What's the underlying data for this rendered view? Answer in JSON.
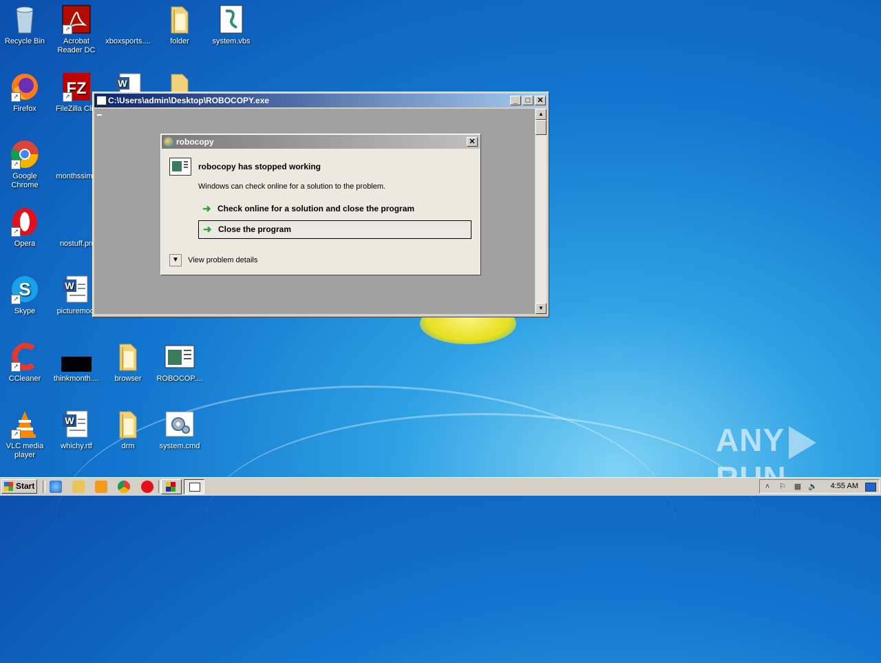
{
  "desktop": {
    "icons": [
      {
        "label": "Recycle Bin",
        "icon": "recycle-bin-icon"
      },
      {
        "label": "Acrobat Reader DC",
        "icon": "acrobat-icon"
      },
      {
        "label": "xboxsports....",
        "icon": "blank-file-icon"
      },
      {
        "label": "folder",
        "icon": "folder-icon"
      },
      {
        "label": "system.vbs",
        "icon": "vbs-script-icon"
      },
      {
        "label": "Firefox",
        "icon": "firefox-icon"
      },
      {
        "label": "FileZilla Clie",
        "icon": "filezilla-icon"
      },
      {
        "label": "Google Chrome",
        "icon": "chrome-icon"
      },
      {
        "label": "monthssimp",
        "icon": "blank-file-icon"
      },
      {
        "label": "Opera",
        "icon": "opera-icon"
      },
      {
        "label": "nostuff.pn",
        "icon": "blank-file-icon"
      },
      {
        "label": "Skype",
        "icon": "skype-icon"
      },
      {
        "label": "picturemodi",
        "icon": "word-doc-icon"
      },
      {
        "label": "CCleaner",
        "icon": "ccleaner-icon"
      },
      {
        "label": "thinkmonth....",
        "icon": "black-file-icon"
      },
      {
        "label": "browser",
        "icon": "folder-icon"
      },
      {
        "label": "ROBOCOP....",
        "icon": "exe-icon"
      },
      {
        "label": "VLC media player",
        "icon": "vlc-icon"
      },
      {
        "label": "whichy.rtf",
        "icon": "word-doc-icon"
      },
      {
        "label": "drm",
        "icon": "folder-icon"
      },
      {
        "label": "system.cmd",
        "icon": "cmd-gear-icon"
      }
    ]
  },
  "console": {
    "title": "C:\\Users\\admin\\Desktop\\ROBOCOPY.exe"
  },
  "dialog": {
    "title": "robocopy",
    "heading": "robocopy has stopped working",
    "message": "Windows can check online for a solution to the problem.",
    "option_check_online": "Check online for a solution and close the program",
    "option_close": "Close the program",
    "details_label": "View problem details"
  },
  "taskbar": {
    "start_label": "Start",
    "clock": "4:55 AM"
  },
  "watermark": {
    "left": "ANY",
    "right": "RUN"
  },
  "colors": {
    "titlebar_active": "#0a246a",
    "dialog_bg": "#ece9e0",
    "arrow_green": "#2fa52f"
  }
}
